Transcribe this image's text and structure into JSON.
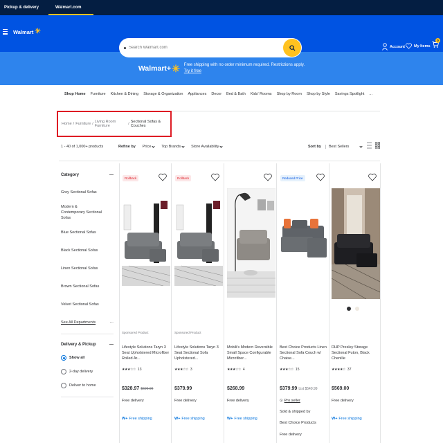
{
  "topbar": {
    "tabs": [
      "Pickup & delivery",
      "Walmart.com"
    ]
  },
  "header": {
    "logo": "Walmart",
    "search_placeholder": "Search Walmart.com",
    "account": "Account",
    "my_items": "My Items",
    "cart_count": "0"
  },
  "banner": {
    "logo": "Walmart+",
    "text": "Free shipping with no order minimum required. Restrictions apply.",
    "link": "Try it free"
  },
  "categories": [
    "Shop Home",
    "Furniture",
    "Kitchen & Dining",
    "Storage & Organization",
    "Appliances",
    "Decor",
    "Bed & Bath",
    "Kids' Rooms",
    "Shop by Room",
    "Shop by Style",
    "Savings Spotlight",
    "..."
  ],
  "breadcrumb": [
    "Home",
    "Furniture",
    "Living Room Furniture",
    "Sectional Sofas & Couches"
  ],
  "results": {
    "count": "1 - 40 of 1,000+ products"
  },
  "filters": {
    "refine_label": "Refine by",
    "items": [
      "Price",
      "Top Brands",
      "Store Availability"
    ]
  },
  "sort": {
    "label": "Sort by",
    "value": "Best Sellers"
  },
  "sidebar": {
    "category_title": "Category",
    "items": [
      "Grey Sectional Sofas",
      "Modern & Contemporary Sectional Sofas",
      "Blue Sectional Sofas",
      "Black Sectional Sofas",
      "Linen Sectional Sofas",
      "Brown Sectional Sofas",
      "Velvet Sectional Sofas"
    ],
    "see_all": "See All Departments",
    "delivery_title": "Delivery & Pickup",
    "delivery_options": [
      "Show all",
      "2-day delivery",
      "Deliver to home"
    ]
  },
  "products": [
    {
      "badge": "Rollback",
      "sponsored": "Sponsored Product",
      "title": "Lifestyle Solutions Taryn 3 Seat Upholstered Microfiber Rolled Ar...",
      "stars": "★★★☆☆",
      "reviews": "13",
      "price": "$328.97",
      "was": "$699.99",
      "shipping": "Free delivery",
      "wplus": "Free shipping"
    },
    {
      "badge": "Rollback",
      "sponsored": "Sponsored Product",
      "title": "Lifestyle Solutions Taryn 3 Seat Sectional Sofa Upholstered...",
      "stars": "★★★☆☆",
      "reviews": "3",
      "price": "$379.99",
      "shipping": "Free delivery",
      "wplus": "Free shipping"
    },
    {
      "badge": "",
      "title": "Mobili's Modern Reversible Small Space Configurable Microfiber...",
      "stars": "★★★☆☆",
      "reviews": "4",
      "price": "$268.99",
      "shipping": "Free delivery",
      "wplus": "Free shipping"
    },
    {
      "badge": "Reduced Price",
      "title": "Best Choice Products Linen Sectional Sofa Couch w/ Chaise...",
      "stars": "★★★☆☆",
      "reviews": "15",
      "price": "$379.99",
      "list": "List $549.99",
      "pro_seller": "Pro seller",
      "sold_by": "Sold & shipped by",
      "seller": "Best Choice Products",
      "shipping": "Free delivery"
    },
    {
      "badge": "",
      "title": "DHP Presley Storage Sectional Futon, Black Chenille",
      "stars": "★★★★☆",
      "reviews": "37",
      "price": "$569.00",
      "shipping": "Free delivery",
      "wplus": "Free shipping"
    }
  ],
  "colors": {
    "navy": "#041e42",
    "blue": "#0053e2",
    "yellow": "#ffc220",
    "banner": "#2e84ed",
    "rollback": "#de1c24"
  }
}
